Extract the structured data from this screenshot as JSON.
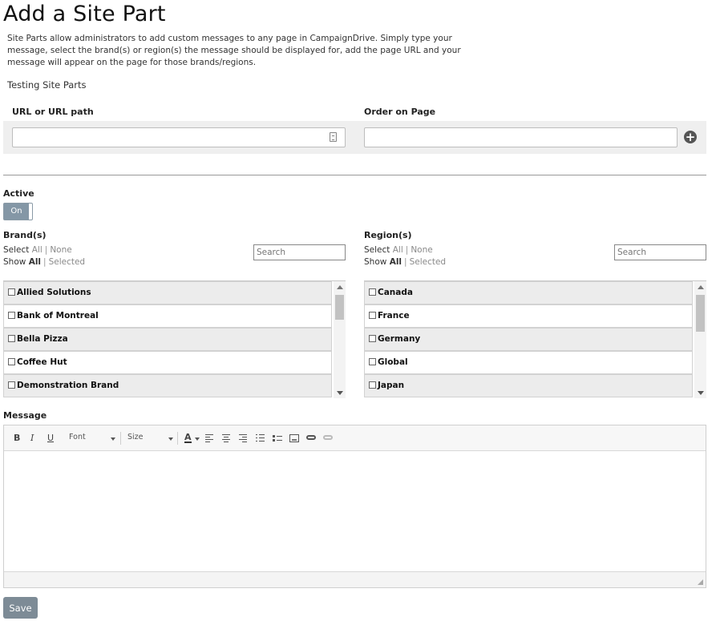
{
  "page": {
    "title": "Add a Site Part",
    "description": "Site Parts allow administrators to add custom messages to any page in CampaignDrive. Simply type your message, select the brand(s) or region(s) the message should be displayed for, add the page URL and your message will appear on the page for those brands/regions.",
    "site_part_name": "Testing Site Parts"
  },
  "url_section": {
    "url_label": "URL or URL path",
    "url_value": "",
    "order_label": "Order on Page",
    "order_value": ""
  },
  "active": {
    "label": "Active",
    "toggle_label": "On",
    "state": "on"
  },
  "brands": {
    "label": "Brand(s)",
    "select_word": "Select",
    "select_all": "All",
    "select_none": "None",
    "show_word": "Show",
    "show_all": "All",
    "show_selected": "Selected",
    "search_placeholder": "Search",
    "items": [
      "Allied Solutions",
      "Bank of Montreal",
      "Bella Pizza",
      "Coffee Hut",
      "Demonstration Brand"
    ]
  },
  "regions": {
    "label": "Region(s)",
    "select_word": "Select",
    "select_all": "All",
    "select_none": "None",
    "show_word": "Show",
    "show_all": "All",
    "show_selected": "Selected",
    "search_placeholder": "Search",
    "items": [
      "Canada",
      "France",
      "Germany",
      "Global",
      "Japan"
    ]
  },
  "message": {
    "label": "Message",
    "toolbar": {
      "bold": "B",
      "italic": "I",
      "underline": "U",
      "font_label": "Font",
      "size_label": "Size",
      "font_color": "A"
    },
    "body": ""
  },
  "actions": {
    "save_label": "Save"
  },
  "colors": {
    "toggle_on": "#8497a6",
    "save_button": "#7d8b96",
    "panel_background": "#efefef",
    "list_row_alt": "#ececec"
  }
}
